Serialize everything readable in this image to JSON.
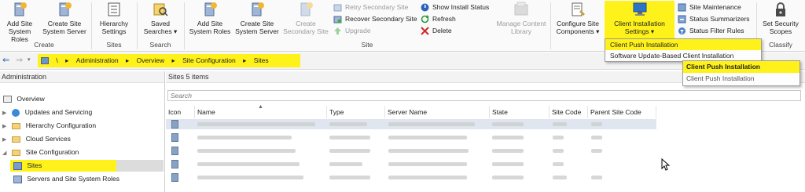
{
  "ribbon": {
    "buttons": {
      "add_site_system_roles_1": "Add Site System Roles",
      "create_site_system_server_1": "Create Site System Server",
      "hierarchy_settings": "Hierarchy Settings",
      "saved_searches": "Saved Searches ▾",
      "add_site_system_roles_2": "Add Site System Roles",
      "create_site_system_server_2": "Create Site System Server",
      "create_secondary_site": "Create Secondary Site",
      "manage_content_library": "Manage Content Library",
      "configure_site_components": "Configure Site Components ▾",
      "client_installation_settings": "Client Installation Settings ▾",
      "set_security_scopes": "Set Security Scopes"
    },
    "small_buttons": {
      "retry_secondary_site": "Retry Secondary Site",
      "recover_secondary_site": "Recover Secondary Site",
      "upgrade": "Upgrade",
      "show_install_status": "Show Install Status",
      "refresh": "Refresh",
      "delete": "Delete",
      "site_maintenance": "Site Maintenance",
      "status_summarizers": "Status Summarizers",
      "status_filter_rules": "Status Filter Rules"
    },
    "groups": {
      "create": "Create",
      "sites": "Sites",
      "search": "Search",
      "site": "Site",
      "classify": "Classify"
    }
  },
  "client_installation_menu": {
    "items": [
      "Client Push Installation",
      "Software Update-Based Client Installation"
    ]
  },
  "client_push_menu": {
    "items": [
      "Client Push Installation",
      "Client Push Installation"
    ]
  },
  "address": {
    "crumbs": [
      "\\",
      "Administration",
      "Overview",
      "Site Configuration",
      "Sites"
    ]
  },
  "nav": {
    "header": "Administration",
    "items": [
      "Overview",
      "Updates and Servicing",
      "Hierarchy Configuration",
      "Cloud Services",
      "Site Configuration",
      "Sites",
      "Servers and Site System Roles"
    ]
  },
  "main": {
    "header": "Sites 5 items",
    "search_placeholder": "Search",
    "columns": [
      "Icon",
      "Name",
      "Type",
      "Server Name",
      "State",
      "Site Code",
      "Parent Site Code"
    ]
  },
  "colors": {
    "highlight": "#fff21a",
    "ribbon_bg": "#fafafa"
  }
}
